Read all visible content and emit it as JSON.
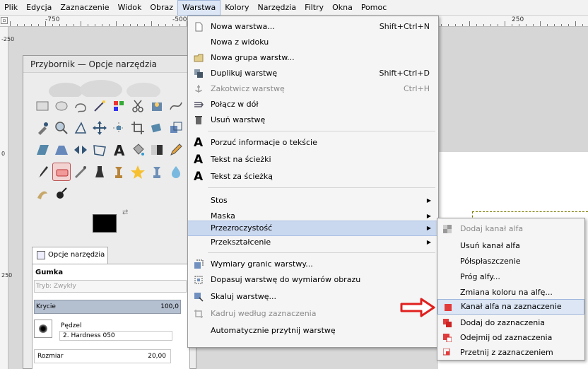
{
  "menubar": {
    "items": [
      {
        "label": "Plik"
      },
      {
        "label": "Edycja"
      },
      {
        "label": "Zaznaczenie"
      },
      {
        "label": "Widok"
      },
      {
        "label": "Obraz"
      },
      {
        "label": "Warstwa"
      },
      {
        "label": "Kolory"
      },
      {
        "label": "Narzędzia"
      },
      {
        "label": "Filtry"
      },
      {
        "label": "Okna"
      },
      {
        "label": "Pomoc"
      }
    ],
    "active": "Warstwa"
  },
  "ruler": {
    "h_labels": [
      "-750",
      "-500",
      "250"
    ],
    "v_labels": [
      "-250",
      "0",
      "250"
    ]
  },
  "toolbox": {
    "title": "Przybornik — Opcje narzędzia",
    "tab_label": "Opcje narzędzia",
    "tool_name": "Gumka",
    "mode_label": "Tryb:",
    "mode_value": "Zwykły",
    "opacity_label": "Krycie",
    "opacity_value": "100,0",
    "brush_label": "Pędzel",
    "brush_value": "2. Hardness 050",
    "size_label": "Rozmiar",
    "size_value": "20,00"
  },
  "layer_menu": {
    "items": [
      {
        "label": "Nowa warstwa...",
        "shortcut": "Shift+Ctrl+N"
      },
      {
        "label": "Nowa z widoku",
        "shortcut": ""
      },
      {
        "label": "Nowa grupa warstw...",
        "shortcut": ""
      },
      {
        "label": "Duplikuj warstwę",
        "shortcut": "Shift+Ctrl+D"
      },
      {
        "label": "Zakotwicz warstwę",
        "shortcut": "Ctrl+H",
        "disabled": true
      },
      {
        "label": "Połącz w dół",
        "shortcut": ""
      },
      {
        "label": "Usuń warstwę",
        "shortcut": ""
      },
      {
        "label": "Porzuć informacje o tekście",
        "shortcut": ""
      },
      {
        "label": "Tekst na ścieżki",
        "shortcut": ""
      },
      {
        "label": "Tekst za ścieżką",
        "shortcut": ""
      },
      {
        "label": "Stos",
        "submenu": true
      },
      {
        "label": "Maska",
        "submenu": true
      },
      {
        "label": "Przezroczystość",
        "submenu": true,
        "highlighted": true
      },
      {
        "label": "Przekształcenie",
        "submenu": true
      },
      {
        "label": "Wymiary granic warstwy...",
        "shortcut": ""
      },
      {
        "label": "Dopasuj warstwę do wymiarów obrazu",
        "shortcut": ""
      },
      {
        "label": "Skaluj warstwę...",
        "shortcut": ""
      },
      {
        "label": "Kadruj według zaznaczenia",
        "shortcut": "",
        "disabled": true
      },
      {
        "label": "Automatycznie przytnij warstwę",
        "shortcut": ""
      }
    ]
  },
  "transparency_submenu": {
    "items": [
      {
        "label": "Dodaj kanał alfa",
        "disabled": true
      },
      {
        "label": "Usuń kanał alfa"
      },
      {
        "label": "Półspłaszczenie"
      },
      {
        "label": "Próg alfy..."
      },
      {
        "label": "Zmiana koloru na alfę..."
      },
      {
        "label": "Kanał alfa na zaznaczenie",
        "highlighted": true
      },
      {
        "label": "Dodaj do zaznaczenia"
      },
      {
        "label": "Odejmij od zaznaczenia"
      },
      {
        "label": "Przetnij z zaznaczeniem"
      }
    ]
  },
  "colors": {
    "accent": "#c9d8ef",
    "arrow": "#e0201e"
  }
}
